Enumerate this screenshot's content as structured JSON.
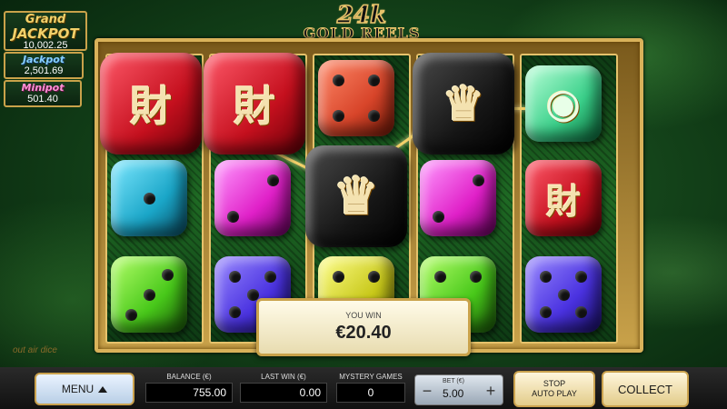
{
  "logo": {
    "top": "24k",
    "bottom": "GOLD REELS"
  },
  "jackpots": {
    "grand": {
      "name1": "Grand",
      "name2": "JACKPOT",
      "value": "10,002.25"
    },
    "jackpot": {
      "name": "Jackpot",
      "value": "2,501.69"
    },
    "minipot": {
      "name": "Minipot",
      "value": "501.40"
    }
  },
  "side_text": "out air dice",
  "win": {
    "label": "YOU WIN",
    "value": "€20.40"
  },
  "symbols": {
    "fortune": "財",
    "jester": "♛",
    "coin": "◉"
  },
  "bar": {
    "menu_label": "MENU",
    "balance_label": "BALANCE (€)",
    "balance_value": "755.00",
    "lastwin_label": "LAST WIN (€)",
    "lastwin_value": "0.00",
    "mystery_label": "MYSTERY GAMES",
    "mystery_value": "0",
    "bet_label": "BET (€)",
    "bet_value": "5.00",
    "bet_minus": "−",
    "bet_plus": "+",
    "stop_label_1": "STOP",
    "stop_label_2": "AUTO PLAY",
    "collect_label": "COLLECT"
  },
  "colors": {
    "gold": "#c9a24a",
    "win_line": "#f3d16a"
  }
}
